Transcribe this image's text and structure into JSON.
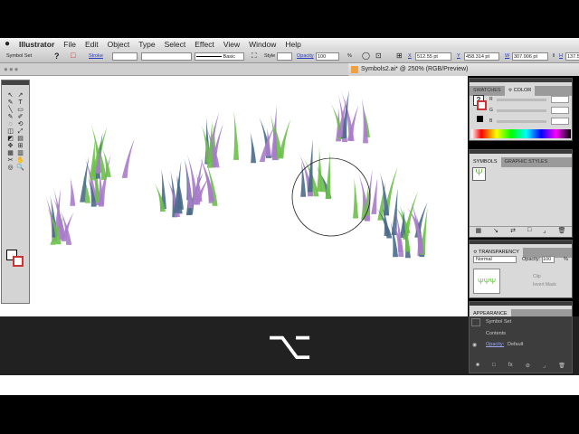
{
  "menubar": {
    "app": "Illustrator",
    "items": [
      "File",
      "Edit",
      "Object",
      "Type",
      "Select",
      "Effect",
      "View",
      "Window",
      "Help"
    ]
  },
  "control": {
    "selection_label": "Symbol Set",
    "stroke_label": "Stroke",
    "brush": "Basic",
    "style_label": "Style",
    "opacity_label": "Opacity",
    "opacity_value": "100",
    "percent": "%",
    "x_label": "X",
    "x_value": "512.55 pt",
    "y_label": "Y",
    "y_value": "458.314 pt",
    "w_label": "W",
    "w_value": "307.906 pt",
    "h_label": "H",
    "h_value": "137.52"
  },
  "document": {
    "title": "Symbols2.ai* @ 250% (RGB/Preview)"
  },
  "color_panel": {
    "tabs": [
      "SWATCHES",
      "≎ COLOR"
    ],
    "channels": [
      "R",
      "G",
      "B"
    ]
  },
  "symbols_panel": {
    "tabs": [
      "SYMBOLS",
      "GRAPHIC STYLES"
    ]
  },
  "transparency_panel": {
    "title": "≎ TRANSPARENCY",
    "mode": "Normal",
    "opacity_label": "Opacity:",
    "opacity_value": "100",
    "percent": "%",
    "clip": "Clip",
    "invert_mask": "Invert Mask"
  },
  "appearance_panel": {
    "title": "APPEARANCE",
    "item": "Symbol Set",
    "contents": "Contents",
    "opacity_label": "Opacity:",
    "opacity_value": "Default"
  },
  "overlay": {
    "key_symbol": "⌥"
  },
  "colors": {
    "grass_green": "#6cc04a",
    "grass_purple": "#a97cc9",
    "grass_blue": "#4a6a8a",
    "overlay": "#282828"
  }
}
